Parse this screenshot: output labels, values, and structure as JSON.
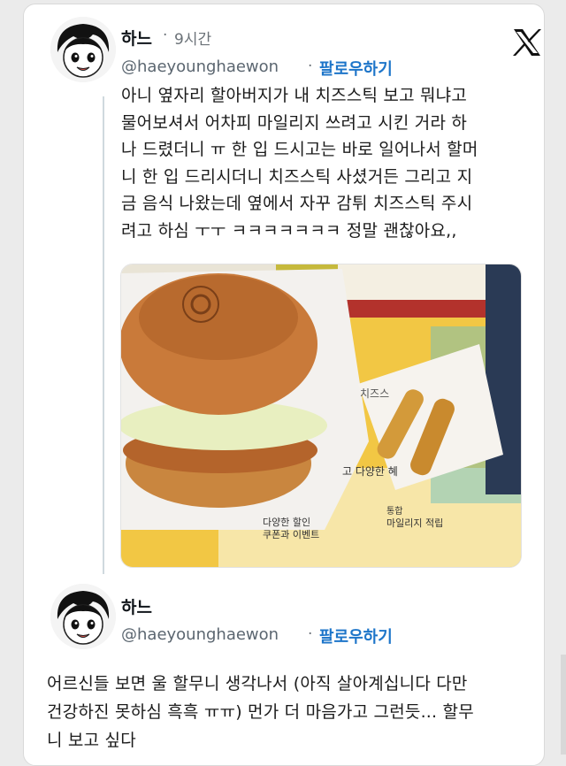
{
  "tweet": {
    "author_name": "하느",
    "separator": "·",
    "time": "9시간",
    "handle": "@haeyounghaewon",
    "handle_separator": "·",
    "follow_label": "팔로우하기",
    "text": "아니 옆자리 할아버지가 내 치즈스틱 보고 뭐냐고\n물어보셔서 어차피 마일리지 쓰려고 시킨 거라 하\n나 드렸더니 ㅠ 한 입 드시고는 바로 일어나서 할머\n니 한 입 드리시더니 치즈스틱 사셨거든 그리고 지\n금 음식 나왔는데 옆에서 자꾸 감튀 치즈스틱 주시\n려고 하심 ㅜㅜ ㅋㅋㅋㅋㅋㅋㅋ 정말 괜찮아요,,",
    "image_icon": "x-logo-icon"
  },
  "photo": {
    "tray_text_1": "다양한 할인",
    "tray_text_2": "쿠폰과 이벤트",
    "tray_text_3": "통합",
    "tray_text_4": "마일리지 적립",
    "tray_text_5": "고 다양한 혜",
    "tray_text_6": "치즈스",
    "colors": {
      "tray": "#f2c744",
      "bun": "#c97a3a",
      "lettuce": "#e8efc0",
      "cup": "#2a3a55"
    }
  },
  "reply": {
    "author_name": "하느",
    "handle": "@haeyounghaewon",
    "handle_separator": "·",
    "follow_label": "팔로우하기",
    "text": "어르신들 보면 울 할무니 생각나서 (아직 살아계십니다 다만\n건강하진 못하심 흑흑 ㅠㅠ) 먼가 더 마음가고 그런듯... 할무\n니 보고 싶다"
  },
  "colors": {
    "link": "#1d75c9",
    "muted": "#6b7278",
    "thread": "#cfd9de"
  }
}
